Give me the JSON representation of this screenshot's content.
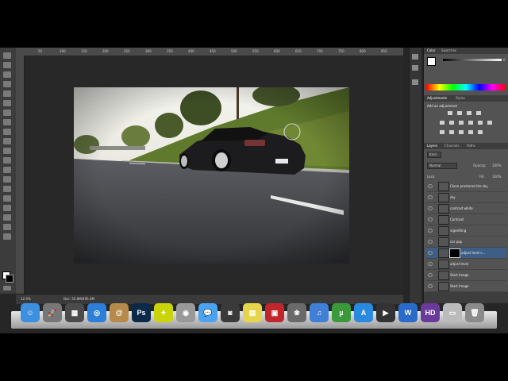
{
  "app": {
    "name": "Photoshop"
  },
  "ruler": {
    "ticks": [
      "50",
      "100",
      "150",
      "200",
      "250",
      "300",
      "350",
      "400",
      "450",
      "500",
      "550",
      "600",
      "650",
      "700",
      "750",
      "800",
      "850"
    ]
  },
  "status": {
    "zoom": "12.5%",
    "doc": "Doc: 55.8M/495.4M"
  },
  "color_panel": {
    "tabs": [
      "Color",
      "Swatches"
    ],
    "active": "Color",
    "slider_value": "0"
  },
  "adjustments_panel": {
    "tabs": [
      "Adjustments",
      "Styles"
    ],
    "active": "Adjustments",
    "heading": "Add an adjustment"
  },
  "layers_panel": {
    "tabs": [
      "Layers",
      "Channels",
      "Paths"
    ],
    "active": "Layers",
    "kind_label": "Kind",
    "blend_mode": "Normal",
    "opacity_label": "Opacity:",
    "opacity_value": "100%",
    "lock_label": "Lock:",
    "fill_label": "Fill:",
    "fill_value": "100%",
    "layers": [
      {
        "name": "Clone prestored the sky",
        "selected": false,
        "mask": false
      },
      {
        "name": "sky",
        "selected": false,
        "mask": false
      },
      {
        "name": "contrast white",
        "selected": false,
        "mask": false
      },
      {
        "name": "Contrast",
        "selected": false,
        "mask": false
      },
      {
        "name": "vignetting",
        "selected": false,
        "mask": false
      },
      {
        "name": "car pop",
        "selected": false,
        "mask": false
      },
      {
        "name": "adjust level c...",
        "selected": true,
        "mask": true
      },
      {
        "name": "adjust level",
        "selected": false,
        "mask": false
      },
      {
        "name": "Start Image",
        "selected": false,
        "mask": false
      },
      {
        "name": "Start Image",
        "selected": false,
        "mask": false
      }
    ]
  },
  "dock": {
    "items": [
      {
        "name": "finder",
        "color": "#3d8fe0",
        "glyph": "☺"
      },
      {
        "name": "launchpad",
        "color": "#777777",
        "glyph": "🚀"
      },
      {
        "name": "mission-control",
        "color": "#4b4b4b",
        "glyph": "▦"
      },
      {
        "name": "safari",
        "color": "#2b7fd8",
        "glyph": "◎"
      },
      {
        "name": "contacts",
        "color": "#b58a4a",
        "glyph": "@"
      },
      {
        "name": "photoshop",
        "color": "#0b2a4a",
        "glyph": "Ps"
      },
      {
        "name": "growl",
        "color": "#c9d40a",
        "glyph": "✦"
      },
      {
        "name": "disk-utility",
        "color": "#999999",
        "glyph": "◉"
      },
      {
        "name": "messages",
        "color": "#4aa3f0",
        "glyph": "💬"
      },
      {
        "name": "facetime",
        "color": "#3a3a3a",
        "glyph": "◙"
      },
      {
        "name": "stickies",
        "color": "#e6d54a",
        "glyph": "▤"
      },
      {
        "name": "photo-booth",
        "color": "#c0262b",
        "glyph": "▣"
      },
      {
        "name": "iphoto",
        "color": "#6a6a6a",
        "glyph": "❀"
      },
      {
        "name": "itunes",
        "color": "#3f7fd6",
        "glyph": "♫"
      },
      {
        "name": "utorrent",
        "color": "#3a9a3a",
        "glyph": "µ"
      },
      {
        "name": "app-store",
        "color": "#2a8ae0",
        "glyph": "A"
      },
      {
        "name": "final-cut",
        "color": "#333333",
        "glyph": "▶"
      },
      {
        "name": "word",
        "color": "#2a6ac8",
        "glyph": "W"
      },
      {
        "name": "media-app",
        "color": "#6a3a9a",
        "glyph": "HD"
      },
      {
        "name": "preview",
        "color": "#bbbbbb",
        "glyph": "▭"
      },
      {
        "name": "trash",
        "color": "#8a8a8a",
        "glyph": "🗑"
      }
    ]
  }
}
